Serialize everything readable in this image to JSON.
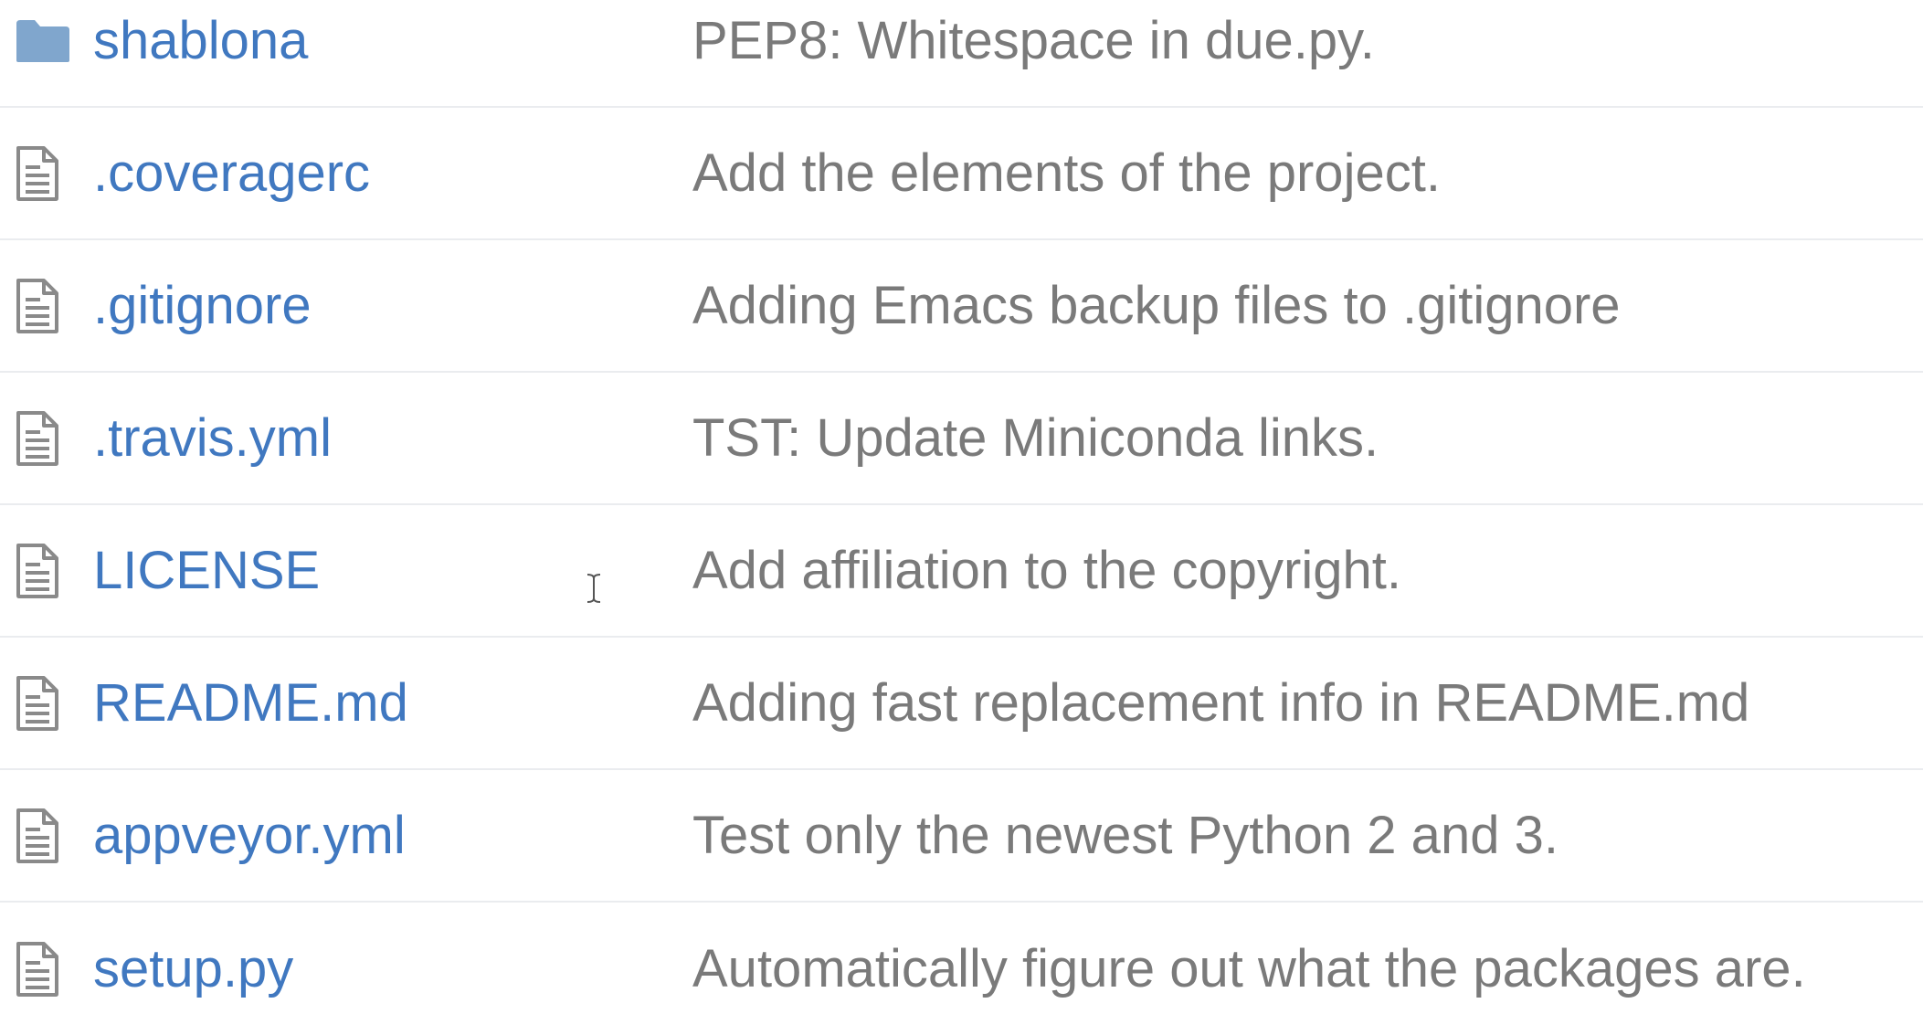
{
  "files": [
    {
      "type": "directory",
      "icon": "folder-icon",
      "name": "shablona",
      "message": "PEP8: Whitespace in due.py."
    },
    {
      "type": "file",
      "icon": "file-icon",
      "name": ".coveragerc",
      "message": "Add the elements of the project."
    },
    {
      "type": "file",
      "icon": "file-icon",
      "name": ".gitignore",
      "message": "Adding Emacs backup files to .gitignore"
    },
    {
      "type": "file",
      "icon": "file-icon",
      "name": ".travis.yml",
      "message": "TST: Update Miniconda links."
    },
    {
      "type": "file",
      "icon": "file-icon",
      "name": "LICENSE",
      "message": "Add affiliation to the copyright."
    },
    {
      "type": "file",
      "icon": "file-icon",
      "name": "README.md",
      "message": "Adding fast replacement info in README.md"
    },
    {
      "type": "file",
      "icon": "file-icon",
      "name": "appveyor.yml",
      "message": "Test only the newest Python 2 and 3."
    },
    {
      "type": "file",
      "icon": "file-icon",
      "name": "setup.py",
      "message": "Automatically figure out what the packages are."
    }
  ],
  "colors": {
    "link": "#4078c0",
    "message": "#7a7a7a",
    "folder": "#80a6cd",
    "file_icon": "#8a8a8a",
    "row_border": "#eaecef"
  }
}
